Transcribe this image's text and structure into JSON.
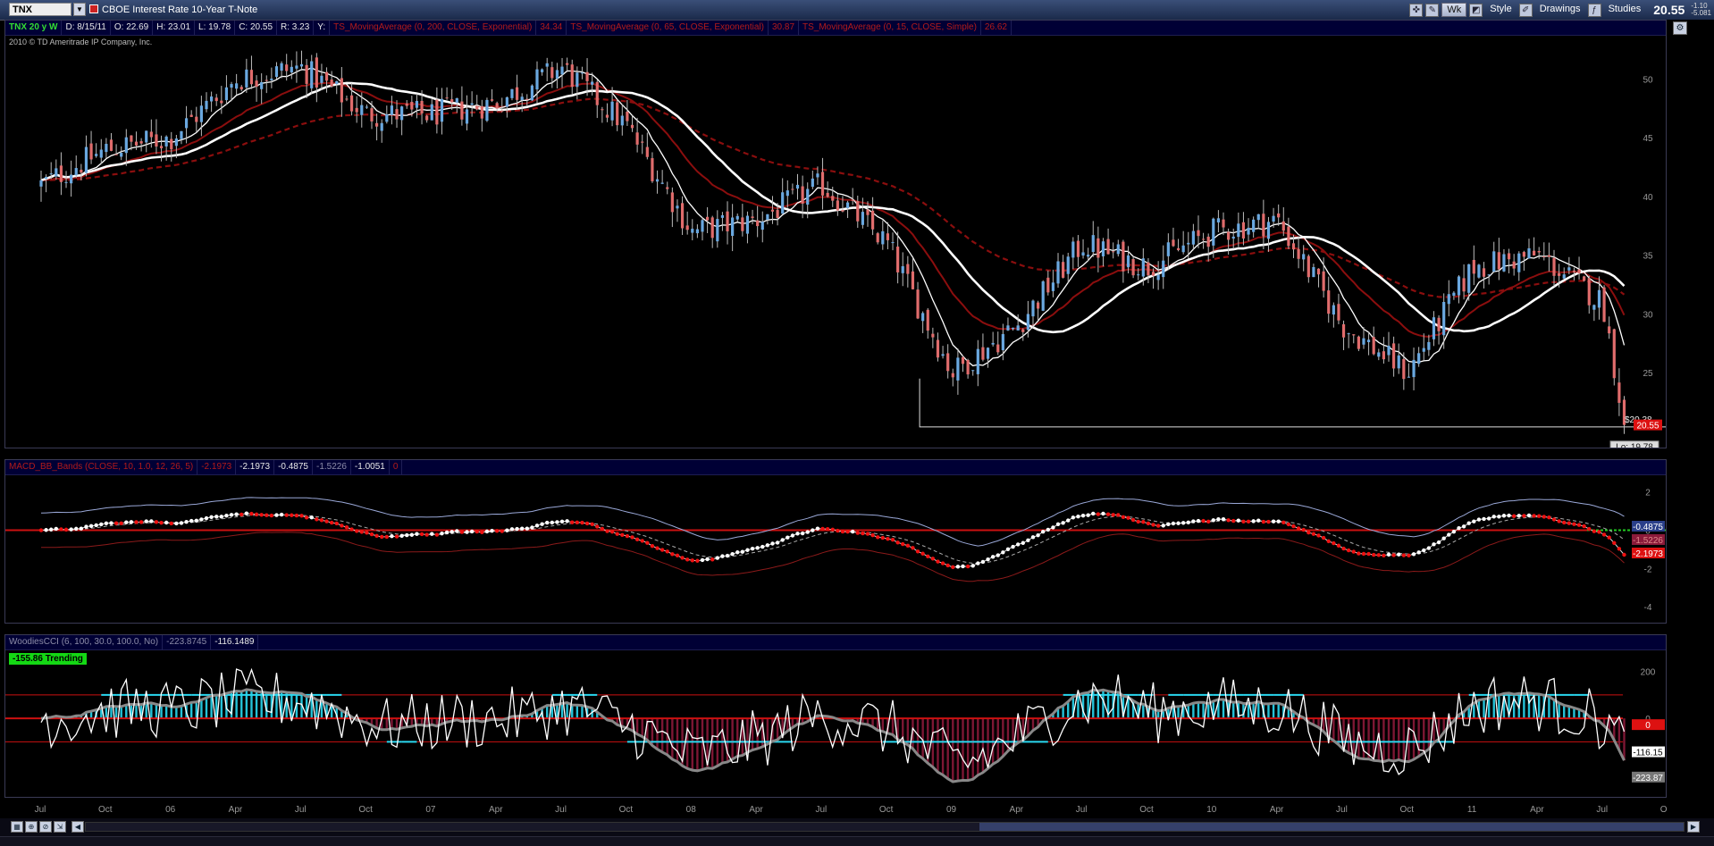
{
  "toolbar": {
    "symbol": "TNX",
    "description": "CBOE Interest Rate 10-Year T-Note",
    "buttons": {
      "wk": "Wk",
      "style": "Style",
      "drawings": "Drawings",
      "studies": "Studies"
    },
    "last_price": "20.55",
    "change": "-1.10",
    "change_pct": "-5.081"
  },
  "price_pane": {
    "header": {
      "symbol_period": "TNX 20 y W",
      "date": "D: 8/15/11",
      "open": "O: 22.69",
      "high": "H: 23.01",
      "low": "L: 19.78",
      "close": "C: 20.55",
      "range": "R: 3.23",
      "y": "Y:",
      "ma200_label": "TS_MovingAverage (0, 200, CLOSE, Exponential)",
      "ma200_value": "34.34",
      "ma65_label": "TS_MovingAverage (0, 65, CLOSE, Exponential)",
      "ma65_value": "30.87",
      "ma15_label": "TS_MovingAverage (0, 15, CLOSE, Simple)",
      "ma15_value": "26.62"
    },
    "copyright": "2010 © TD Ameritrade IP Company, Inc.",
    "axis_ticks": [
      "50",
      "45",
      "40",
      "35",
      "30",
      "25"
    ],
    "support_label": "$20.38",
    "last_label": "20.55",
    "low_label": "Lo: 19.78"
  },
  "macd_pane": {
    "header": {
      "study": "MACD_BB_Bands (CLOSE, 10, 1.0, 12, 26, 5)",
      "v1": "-2.1973",
      "v2": "-2.1973",
      "v3": "-0.4875",
      "v4": "-1.5226",
      "v5": "-1.0051",
      "v6": "0"
    },
    "axis_ticks": [
      "2",
      "0",
      "-2",
      "-4"
    ],
    "labels": {
      "upper": "-0.4875",
      "mid": "-1.5226",
      "macd": "-2.1973"
    }
  },
  "cci_pane": {
    "header": {
      "study": "WoodiesCCI (6, 100, 30.0, 100.0, No)",
      "v1": "-223.8745",
      "v2": "-116.1489"
    },
    "trend_badge": "-155.86  Trending",
    "axis_ticks": [
      "200",
      "0"
    ],
    "labels": {
      "zero": "0",
      "cci6": "-116.15",
      "cci14": "-223.87"
    }
  },
  "x_axis": [
    "Jul",
    "Oct",
    "06",
    "Apr",
    "Jul",
    "Oct",
    "07",
    "Apr",
    "Jul",
    "Oct",
    "08",
    "Apr",
    "Jul",
    "Oct",
    "09",
    "Apr",
    "Jul",
    "Oct",
    "10",
    "Apr",
    "Jul",
    "Oct",
    "11",
    "Apr",
    "Jul",
    "Oct"
  ],
  "colors": {
    "up": "#6aa8e0",
    "down": "#e06c6c",
    "ma_red": "#8b0e0e",
    "ma_white": "#ffffff",
    "cci_cyan": "#2ad8f0",
    "cci_maroon": "#8b1a3a",
    "green_badge": "#14d814"
  },
  "chart_data": {
    "type": "line",
    "title": "TNX 20 y W",
    "x": [
      "2005-07",
      "2005-10",
      "2006-01",
      "2006-04",
      "2006-07",
      "2006-10",
      "2007-01",
      "2007-04",
      "2007-07",
      "2007-10",
      "2008-01",
      "2008-04",
      "2008-07",
      "2008-10",
      "2009-01",
      "2009-04",
      "2009-07",
      "2009-10",
      "2010-01",
      "2010-04",
      "2010-07",
      "2010-10",
      "2011-01",
      "2011-04",
      "2011-07",
      "2011-08"
    ],
    "series": [
      {
        "name": "TNX",
        "values": [
          41,
          44,
          45,
          50,
          51,
          47,
          47,
          48,
          51,
          46,
          37,
          38,
          41,
          36,
          25,
          29,
          36,
          34,
          37,
          38,
          29,
          25,
          34,
          35,
          31,
          20.55
        ]
      }
    ],
    "ylim": [
      19,
      53
    ]
  }
}
